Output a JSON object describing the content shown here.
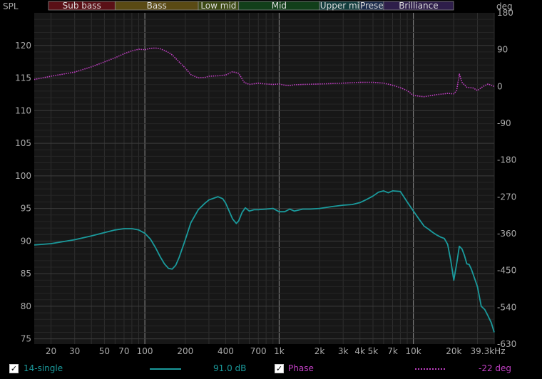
{
  "chart_data": {
    "type": "line",
    "y_left_label": "SPL",
    "y_right_label": "deg",
    "x_scale": "log",
    "xlim": [
      15,
      40000
    ],
    "ylim_left": [
      74.2,
      125
    ],
    "ylim_right": [
      -630,
      180
    ],
    "x_ticks": [
      {
        "v": 20,
        "label": "20"
      },
      {
        "v": 30,
        "label": "30"
      },
      {
        "v": 50,
        "label": "50"
      },
      {
        "v": 70,
        "label": "70"
      },
      {
        "v": 100,
        "label": "100"
      },
      {
        "v": 200,
        "label": "200"
      },
      {
        "v": 400,
        "label": "400"
      },
      {
        "v": 700,
        "label": "700"
      },
      {
        "v": 1000,
        "label": "1k"
      },
      {
        "v": 2000,
        "label": "2k"
      },
      {
        "v": 3000,
        "label": "3k"
      },
      {
        "v": 4000,
        "label": "4k"
      },
      {
        "v": 5000,
        "label": "5k"
      },
      {
        "v": 7000,
        "label": "7k"
      },
      {
        "v": 10000,
        "label": "10k"
      },
      {
        "v": 20000,
        "label": "20k"
      },
      {
        "v": 39300,
        "label": "39.3kHz"
      }
    ],
    "y_left_ticks": [
      75,
      80,
      85,
      90,
      95,
      100,
      105,
      110,
      115,
      120
    ],
    "y_right_ticks": [
      180,
      90,
      0,
      -90,
      -180,
      -270,
      -360,
      -450,
      -540,
      -630
    ],
    "bands": [
      {
        "label": "Sub bass",
        "from": 15,
        "to": 60,
        "color": "#5a1016"
      },
      {
        "label": "Bass",
        "from": 60,
        "to": 250,
        "color": "#5a4a14"
      },
      {
        "label": "Low mid",
        "from": 250,
        "to": 500,
        "color": "#3d4a14"
      },
      {
        "label": "Mid",
        "from": 500,
        "to": 2000,
        "color": "#123f1a"
      },
      {
        "label": "Upper mi",
        "from": 2000,
        "to": 4000,
        "color": "#123d3d"
      },
      {
        "label": "Prese",
        "from": 4000,
        "to": 6000,
        "color": "#1a2a4a"
      },
      {
        "label": "Brilliance",
        "from": 6000,
        "to": 20000,
        "color": "#2e1e4a"
      }
    ],
    "series": [
      {
        "name": "14-single",
        "axis": "left",
        "color": "#1a9a9c",
        "x": [
          15,
          20,
          30,
          40,
          50,
          60,
          70,
          80,
          90,
          100,
          110,
          120,
          130,
          140,
          150,
          160,
          170,
          180,
          200,
          220,
          250,
          280,
          300,
          350,
          380,
          400,
          420,
          450,
          480,
          500,
          530,
          560,
          600,
          650,
          700,
          800,
          900,
          1000,
          1100,
          1200,
          1300,
          1500,
          1700,
          2000,
          2500,
          3000,
          3500,
          4000,
          4500,
          5000,
          5500,
          6000,
          6500,
          7000,
          8000,
          9000,
          10000,
          11000,
          12000,
          13000,
          14000,
          15000,
          16000,
          17000,
          18000,
          19000,
          20000,
          21000,
          22000,
          23000,
          24000,
          25000,
          26000,
          27000,
          28000,
          30000,
          32000,
          34000,
          36000,
          38000,
          40000
        ],
        "y": [
          89.4,
          89.6,
          90.2,
          90.8,
          91.3,
          91.7,
          91.9,
          91.9,
          91.7,
          91.2,
          90.3,
          89.0,
          87.6,
          86.5,
          85.8,
          85.7,
          86.3,
          87.5,
          90.2,
          92.8,
          94.8,
          95.8,
          96.3,
          96.8,
          96.5,
          95.8,
          94.8,
          93.4,
          92.7,
          93.1,
          94.4,
          95.1,
          94.6,
          94.8,
          94.8,
          94.9,
          95.0,
          94.5,
          94.5,
          94.9,
          94.6,
          94.9,
          94.9,
          95.0,
          95.3,
          95.5,
          95.6,
          95.9,
          96.4,
          96.9,
          97.5,
          97.7,
          97.4,
          97.7,
          97.6,
          96.0,
          94.6,
          93.4,
          92.3,
          91.8,
          91.3,
          90.9,
          90.6,
          90.4,
          89.5,
          87.0,
          84.0,
          86.5,
          89.2,
          88.8,
          87.8,
          86.5,
          86.4,
          85.7,
          84.8,
          83.0,
          80.0,
          79.5,
          78.5,
          77.5,
          76.0
        ]
      },
      {
        "name": "Phase",
        "axis": "right",
        "color": "#c23fc5",
        "x": [
          15,
          20,
          30,
          40,
          50,
          60,
          70,
          80,
          90,
          100,
          110,
          120,
          130,
          140,
          150,
          160,
          180,
          200,
          220,
          250,
          280,
          300,
          350,
          400,
          450,
          500,
          550,
          600,
          700,
          800,
          900,
          1000,
          1100,
          1200,
          1300,
          1500,
          2000,
          3000,
          4000,
          5000,
          6000,
          7000,
          8000,
          9000,
          10000,
          12000,
          15000,
          18000,
          20000,
          21000,
          22000,
          23000,
          25000,
          28000,
          30000,
          33000,
          36000,
          40000
        ],
        "y": [
          17,
          25,
          35,
          48,
          60,
          70,
          80,
          87,
          91,
          90,
          93,
          94,
          92,
          88,
          83,
          77,
          60,
          45,
          29,
          21,
          22,
          25,
          26,
          28,
          36,
          32,
          10,
          5,
          8,
          6,
          5,
          6,
          3,
          2,
          4,
          5,
          6,
          8,
          10,
          10,
          8,
          3,
          -3,
          -10,
          -22,
          -25,
          -20,
          -17,
          -18,
          -10,
          30,
          10,
          -2,
          -4,
          -10,
          0,
          6,
          0
        ]
      }
    ],
    "legend": {
      "series_label": "14-single",
      "series_value": "91.0 dB",
      "phase_label": "Phase",
      "phase_value": "-22 deg"
    }
  }
}
